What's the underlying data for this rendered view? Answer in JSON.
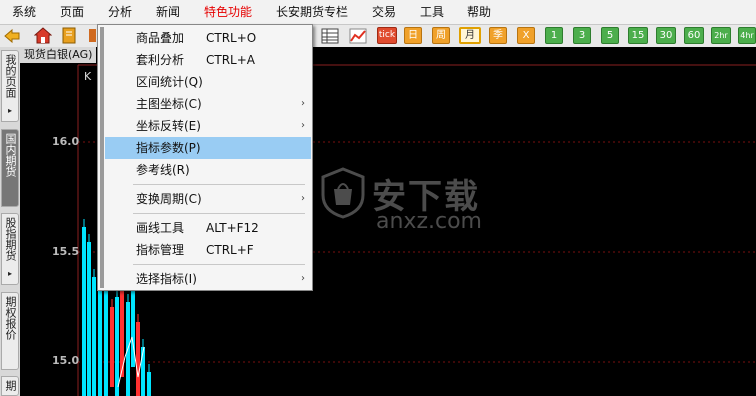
{
  "menubar": {
    "items": [
      "系统",
      "页面",
      "分析",
      "新闻",
      "特色功能",
      "长安期货专栏",
      "交易",
      "工具",
      "帮助"
    ]
  },
  "toolbar": {
    "buttons": [
      "tick",
      "日",
      "周",
      "月",
      "季",
      "X",
      "1",
      "3",
      "5",
      "15",
      "30",
      "60",
      "2hr",
      "4hr"
    ],
    "active_button": "月"
  },
  "left_tabs": [
    "我的页面",
    "国内期货",
    "股指期货",
    "期权报价",
    "期"
  ],
  "active_left_tab": "国内期货",
  "chart": {
    "title": "现货白银(AG)",
    "marker": "K",
    "y_ticks": [
      "16.0",
      "15.5",
      "15.0"
    ]
  },
  "chart_data": {
    "type": "candlestick",
    "y_ticks": [
      16.0,
      15.5,
      15.0
    ],
    "grid": true
  },
  "dropdown": {
    "items": [
      {
        "label": "商品叠加",
        "shortcut": "CTRL+O"
      },
      {
        "label": "套利分析",
        "shortcut": "CTRL+A"
      },
      {
        "label": "区间统计(Q)",
        "shortcut": ""
      },
      {
        "label": "主图坐标(C)",
        "shortcut": "",
        "submenu": true
      },
      {
        "label": "坐标反转(E)",
        "shortcut": "",
        "submenu": true
      },
      {
        "label": "指标参数(P)",
        "shortcut": "",
        "highlighted": true
      },
      {
        "label": "参考线(R)",
        "shortcut": ""
      },
      {
        "label": "变换周期(C)",
        "shortcut": "",
        "submenu": true
      },
      {
        "label": "画线工具",
        "shortcut": "ALT+F12"
      },
      {
        "label": "指标管理",
        "shortcut": "CTRL+F"
      },
      {
        "label": "选择指标(I)",
        "shortcut": "",
        "submenu": true
      }
    ],
    "submenu_arrow": "›"
  },
  "watermark": {
    "text": "安下载",
    "subtext": "anxz.com"
  },
  "colors": {
    "menu_highlight": "#99ccf3",
    "special_menu_text": "#e60000",
    "candle_up": "#00e5ff",
    "candle_down": "#ff3030",
    "grid": "#7a1010"
  }
}
